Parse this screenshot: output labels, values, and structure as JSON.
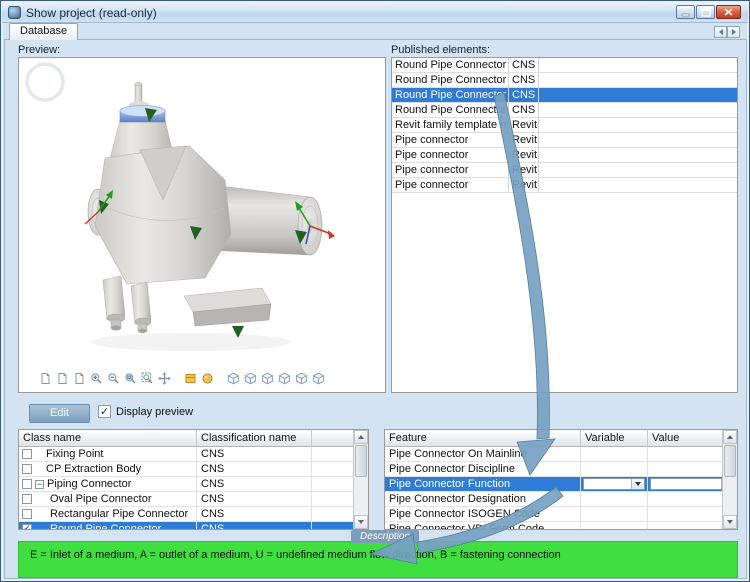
{
  "window": {
    "title": "Show project  (read-only)"
  },
  "tabs": {
    "database": "Database"
  },
  "preview": {
    "label": "Preview:",
    "toolbar": [
      {
        "name": "new-document-icon",
        "glyph": "doc"
      },
      {
        "name": "open-document-icon",
        "glyph": "doc"
      },
      {
        "name": "print-preview-icon",
        "glyph": "doc"
      },
      {
        "name": "zoom-in-icon",
        "glyph": "zoomin"
      },
      {
        "name": "zoom-out-icon",
        "glyph": "zoomout"
      },
      {
        "name": "zoom-window-icon",
        "glyph": "zoomwin"
      },
      {
        "name": "zoom-fit-icon",
        "glyph": "zoomfit"
      },
      {
        "name": "pan-icon",
        "glyph": "pan"
      },
      {
        "name": "separator"
      },
      {
        "name": "shading-mode-icon",
        "glyph": "shade"
      },
      {
        "name": "material-render-icon",
        "glyph": "mat"
      },
      {
        "name": "separator"
      },
      {
        "name": "iso-view-icon",
        "glyph": "cube"
      },
      {
        "name": "front-view-icon",
        "glyph": "cube"
      },
      {
        "name": "top-view-icon",
        "glyph": "cube"
      },
      {
        "name": "side-view-icon",
        "glyph": "cube"
      },
      {
        "name": "back-view-icon",
        "glyph": "cube"
      },
      {
        "name": "rotate-view-icon",
        "glyph": "cube"
      }
    ]
  },
  "published": {
    "label": "Published elements:",
    "rows": [
      {
        "name": "Round Pipe Connector",
        "type": "CNS",
        "selected": false
      },
      {
        "name": "Round Pipe Connector",
        "type": "CNS",
        "selected": false
      },
      {
        "name": "Round Pipe Connector",
        "type": "CNS",
        "selected": true
      },
      {
        "name": "Round Pipe Connector",
        "type": "CNS",
        "selected": false
      },
      {
        "name": "Revit family template mapping",
        "type": "Revit",
        "selected": false
      },
      {
        "name": "Pipe connector",
        "type": "Revit",
        "selected": false
      },
      {
        "name": "Pipe connector",
        "type": "Revit",
        "selected": false
      },
      {
        "name": "Pipe connector",
        "type": "Revit",
        "selected": false
      },
      {
        "name": "Pipe connector",
        "type": "Revit",
        "selected": false
      }
    ]
  },
  "actions": {
    "edit": "Edit",
    "display_preview": "Display preview",
    "display_preview_checked": true
  },
  "class_table": {
    "headers": [
      "Class name",
      "Classification name"
    ],
    "rows": [
      {
        "label": "Fixing Point",
        "classification": "CNS",
        "checked": false,
        "level": 0,
        "expander": false,
        "selected": false
      },
      {
        "label": "CP Extraction Body",
        "classification": "CNS",
        "checked": false,
        "level": 0,
        "expander": false,
        "selected": false
      },
      {
        "label": "Piping Connector",
        "classification": "CNS",
        "checked": false,
        "level": 0,
        "expander": true,
        "selected": false
      },
      {
        "label": "Oval Pipe Connector",
        "classification": "CNS",
        "checked": false,
        "level": 1,
        "expander": false,
        "selected": false
      },
      {
        "label": "Rectangular Pipe Connector",
        "classification": "CNS",
        "checked": false,
        "level": 1,
        "expander": false,
        "selected": false
      },
      {
        "label": "Round Pipe Connector",
        "classification": "CNS",
        "checked": true,
        "level": 1,
        "expander": false,
        "selected": true
      }
    ]
  },
  "feature_table": {
    "headers": [
      "Feature",
      "Variable",
      "Value"
    ],
    "rows": [
      {
        "name": "Pipe Connector On Mainline",
        "selected": false
      },
      {
        "name": "Pipe Connector Discipline",
        "selected": false
      },
      {
        "name": "Pipe Connector Function",
        "selected": true,
        "combos": true
      },
      {
        "name": "Pipe Connector Designation",
        "selected": false
      },
      {
        "name": "Pipe Connector ISOGEN Code",
        "selected": false
      },
      {
        "name": "Pipe Connector VDI Form Code",
        "selected": false
      }
    ]
  },
  "description": {
    "label": "Description",
    "text": "E = Inlet of a medium, A = outlet of a medium, U = undefined medium flow direction, B = fastening connection"
  },
  "colors": {
    "selection": "#2f7cd6",
    "description_green": "#3fdf3f",
    "annotation_arrow": "#76a1c2"
  }
}
